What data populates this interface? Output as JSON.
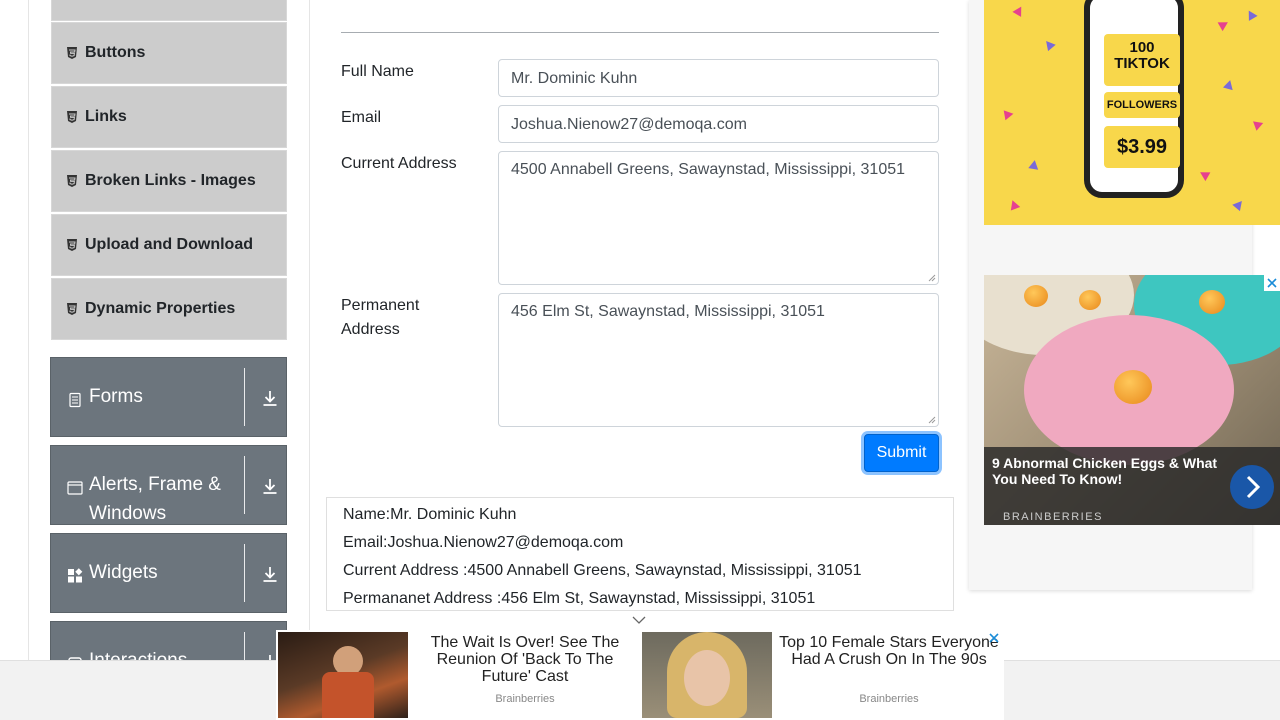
{
  "sidebar": {
    "element_items": [
      {
        "label": "Buttons"
      },
      {
        "label": "Links"
      },
      {
        "label": "Broken Links - Images"
      },
      {
        "label": "Upload and Download"
      },
      {
        "label": "Dynamic Properties"
      }
    ],
    "groups": [
      {
        "label": "Forms"
      },
      {
        "label": "Alerts, Frame &",
        "label2": "Windows"
      },
      {
        "label": "Widgets"
      },
      {
        "label": "Interactions"
      }
    ]
  },
  "form": {
    "full_name_label": "Full Name",
    "full_name_value": "Mr. Dominic Kuhn",
    "email_label": "Email",
    "email_value": "Joshua.Nienow27@demoqa.com",
    "current_address_label": "Current Address",
    "current_address_value": "4500 Annabell Greens, Sawaynstad, Mississippi, 31051",
    "permanent_address_label": "Permanent Address",
    "permanent_address_value": "456 Elm St, Sawaynstad, Mississippi, 31051",
    "submit_label": "Submit"
  },
  "output": {
    "name": "Name:Mr. Dominic Kuhn",
    "email": "Email:Joshua.Nienow27@demoqa.com",
    "current_address": "Current Address :4500 Annabell Greens, Sawaynstad, Mississippi, 31051",
    "permanent_address": "Permananet Address :456 Elm St, Sawaynstad, Mississippi, 31051"
  },
  "ads": {
    "tiktok": {
      "line1": "100",
      "line2": "TIKTOK",
      "line3": "FOLLOWERS",
      "price": "$3.99"
    },
    "eggs": {
      "title": "9 Abnormal Chicken Eggs & What You Need To Know!",
      "brand": "BRAINBERRIES"
    },
    "bottom": [
      {
        "title": "The Wait Is Over! See The Reunion Of 'Back To The Future' Cast",
        "brand": "Brainberries"
      },
      {
        "title": "Top 10 Female Stars Everyone Had A Crush On In The 90s",
        "brand": "Brainberries"
      }
    ]
  },
  "colors": {
    "accent": "#007bff",
    "group_bg": "#6c757d",
    "item_bg": "#cccccc",
    "ad_yellow": "#f8d74b"
  }
}
